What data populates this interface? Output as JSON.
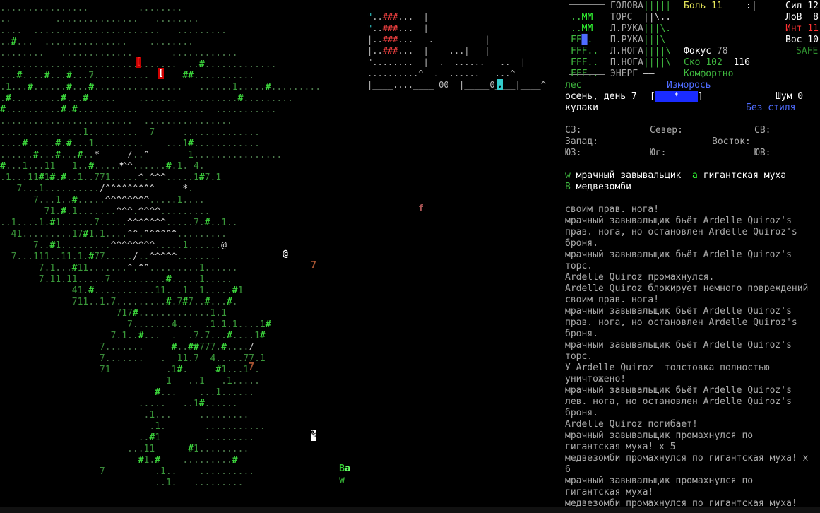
{
  "map": {
    "rows": [
      "................         ........",
      "..        ...............   ........",
      "....  .......................   .........",
      "..#...  ...............    ........",
      "........   .............       ............",
      "................................  ..#.............",
      "...#....#...#...7..........      ##...........",
      ".1...#......#...#................   ......1.....#.........",
      ".#.........#...#.....    .......  .........#.........",
      "#..........#.#...........  ..........  ...........",
      "........................  ................",
      "...............1.........  7     ..............",
      "....#.....#.#...1.........    ...1#............",
      "......#...#...#..*     /..^       1................",
      "#...1...11   1..#.....^^......#.1. 4.",
      ".1...11#1#.#..1..771.....^.^^^.....1#7.1",
      "   7...1........../^^^^^^^^^     *.",
      "      7...1..#.....^^^^^^^^.....1....",
      "        71.#.1.......^^^.^^^^.........",
      "..1....1.#1......7.....^^^^^^^.....7.#..1..",
      "  41.........17#1.1....^^.^^^^^^.........",
      "      7..#1.........^^^^^^^^.....1......@",
      "  7...111..11.1.#77...../..^^^^^........",
      "       7.1...#11.......^.^^.........1......",
      "       7.11.11.....7..........#.....1.....",
      "             41.#...........11...1..1.....#1",
      "             711..1.7.........#.7#7..#...#.",
      "                     717#.............1.1",
      "                       7.......4...  .1.1.1....1#",
      "                    7.1..#...  .  .7.7...#....1#",
      "                  7.......     #..##777.#..../",
      "                  7.......   .  11.7  4.....77.1",
      "                  71          .1#.     #1...1..",
      "                              1   ..1   .1.....",
      "                            #...    ...1......",
      "                         .....   ..1#......",
      "                          .1...     .........",
      "                           .1.       ...........",
      "                         ..#1        .........",
      "                       ...11      #1.........",
      "                         #1.#    .........#",
      "                  7         .1..    ..........",
      "                            ..1.   ......... "
    ],
    "markers": [
      {
        "glyph": "[",
        "color": "#ff2020",
        "bg": "#c00000",
        "name": "red-bracket-marker-1"
      },
      {
        "glyph": "[",
        "color": "#ffffff",
        "bg": "#d00000",
        "name": "red-bracket-marker-2"
      },
      {
        "glyph": "@",
        "color": "#ffffff",
        "bg": "#000000",
        "name": "player-marker"
      },
      {
        "glyph": ",",
        "color": "#000000",
        "bg": "#33cccc",
        "name": "cyan-item-marker"
      },
      {
        "glyph": "%",
        "color": "#000000",
        "bg": "#ffffff",
        "name": "corpse-marker"
      },
      {
        "glyph": "B",
        "color": "#33cc33",
        "bg": "#000000",
        "name": "bear-zombie-marker"
      },
      {
        "glyph": "a",
        "color": "#66ff66",
        "bg": "#000000",
        "name": "giant-fly-marker"
      },
      {
        "glyph": "w",
        "color": "#33aa33",
        "bg": "#000000",
        "name": "dreary-howler-marker"
      },
      {
        "glyph": "f",
        "color": "#aa5555",
        "bg": "#000000",
        "name": "f-marker"
      },
      {
        "glyph": "7",
        "color": "#aa5533",
        "bg": "#000000",
        "name": "brown-seven-marker-1"
      },
      {
        "glyph": "7",
        "color": "#aa5533",
        "bg": "#000000",
        "name": "brown-seven-marker-2"
      },
      {
        "glyph": "*",
        "color": "#dddddd",
        "bg": "#000000",
        "name": "star-marker"
      }
    ]
  },
  "body_parts": [
    {
      "label": "ГОЛОВА",
      "bar": "|||||"
    },
    {
      "label": "ТОРС",
      "bar": "  ||\\.."
    },
    {
      "label": "Л.РУКА",
      "bar": "|||\\."
    },
    {
      "label": "П.РУКА",
      "bar": "|||\\"
    },
    {
      "label": "Л.НОГА",
      "bar": "||||\\"
    },
    {
      "label": "П.НОГА",
      "bar": "||||\\"
    },
    {
      "label": "ЭНЕРГ",
      "bar": " ——"
    }
  ],
  "minimap": [
    "..MM",
    "..MM",
    "FF█.",
    "FFF..",
    "FFF..",
    "FFF.."
  ],
  "stats": {
    "pain_label": "Боль",
    "pain_value": "11",
    "pain_extra": ":|",
    "focus_label": "Фокус",
    "focus_value": "78",
    "speed_label": "Ско",
    "speed_value": "102",
    "speed_extra": "116",
    "comfort": "Комфортно",
    "str": "Сил 12",
    "dex": "ЛоВ  8",
    "int": "Инт 11",
    "per": "Вос 10",
    "safe": "SAFE"
  },
  "environment": {
    "terrain": "лес",
    "weather": "Изморось",
    "date": "осень, день 7",
    "time_bar_left": "[",
    "time_bar_star": "*",
    "time_bar_right": "]",
    "noise": "Шум 0",
    "weapon": "кулаки",
    "style": "Без стиля"
  },
  "directions": {
    "nw": "СЗ:",
    "n": "Север:",
    "ne": "СВ:",
    "w": "Запад:",
    "e": "Восток:",
    "sw": "ЮЗ:",
    "s": "Юг:",
    "se": "ЮВ:"
  },
  "creatures": [
    {
      "glyph": "w",
      "name": "мрачный завывальщик"
    },
    {
      "glyph": "a",
      "name": "гигантская муха"
    },
    {
      "glyph": "B",
      "name": "медвезомби"
    }
  ],
  "log": [
    "своим прав. нога!",
    "мрачный завывальщик бьёт Ardelle Quiroz's",
    "прав. нога, но остановлен Ardelle Quiroz's",
    "броня.",
    "мрачный завывальщик бьёт Ardelle Quiroz's",
    "торс.",
    "Ardelle Quiroz промахнулся.",
    "Ardelle Quiroz блокирует немного повреждений",
    "своим прав. нога!",
    "мрачный завывальщик бьёт Ardelle Quiroz's",
    "прав. нога, но остановлен Ardelle Quiroz's",
    "броня.",
    "мрачный завывальщик бьёт Ardelle Quiroz's",
    "торс.",
    "У Ardelle Quiroz  толстовка полностью",
    "уничтожено!",
    "мрачный завывальщик бьёт Ardelle Quiroz's",
    "лев. нога, но остановлен Ardelle Quiroz's",
    "броня.",
    "Ardelle Quiroz погибает!",
    "мрачный завывальщик промахнулся по",
    "гигантская муха! x 5",
    "медвезомби промахнулся по гигантская муха! x",
    "6",
    "мрачный завывальщик промахнулся по",
    "гигантская муха!",
    "медвезомби промахнулся по гигантская муха!"
  ],
  "colors": {
    "background": "#000000",
    "text": "#aaaaaa",
    "green": "#3fb83f",
    "yellow": "#e8e85a",
    "red": "#ff3333",
    "blue": "#4f6cff",
    "cyan": "#33dddd"
  }
}
